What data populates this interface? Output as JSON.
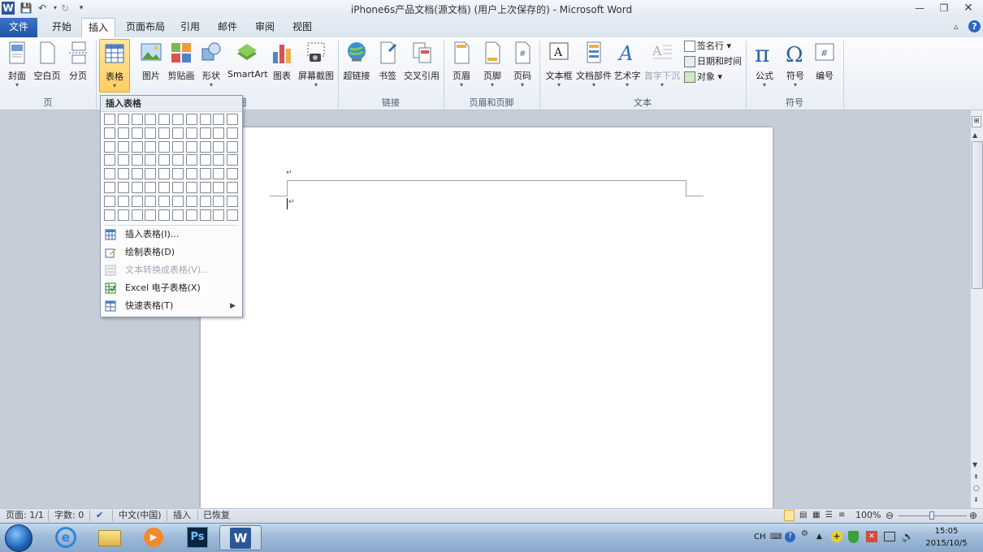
{
  "title": "iPhone6s产品文档(源文档) (用户上次保存的) - Microsoft Word",
  "tabs": {
    "file": "文件",
    "home": "开始",
    "insert": "插入",
    "layout": "页面布局",
    "references": "引用",
    "mail": "邮件",
    "review": "审阅",
    "view": "视图"
  },
  "ribbon": {
    "cover": "封面",
    "blank": "空白页",
    "break": "分页",
    "table": "表格",
    "picture": "图片",
    "clipart": "剪贴画",
    "shapes": "形状",
    "smartart": "SmartArt",
    "chart": "图表",
    "screenshot": "屏幕截图",
    "hyperlink": "超链接",
    "bookmark": "书签",
    "crossref": "交叉引用",
    "header": "页眉",
    "footer": "页脚",
    "pagenum": "页码",
    "textbox": "文本框",
    "quickparts": "文档部件",
    "wordart": "艺术字",
    "dropcap": "首字下沉",
    "signature": "签名行",
    "datetime": "日期和时间",
    "object": "对象",
    "equation": "公式",
    "symbol": "符号",
    "number": "编号",
    "groups": {
      "pages": "页",
      "links": "链接",
      "headerfooter": "页眉和页脚",
      "text": "文本",
      "symbols": "符号",
      "illus_tail": "图"
    }
  },
  "dropdown": {
    "header": "插入表格",
    "items": [
      "插入表格(I)...",
      "绘制表格(D)",
      "文本转换成表格(V)...",
      "Excel 电子表格(X)",
      "快速表格(T)"
    ]
  },
  "doc": {
    "para_mark": "↵"
  },
  "status": {
    "page": "页面: 1/1",
    "words": "字数: 0",
    "lang": "中文(中国)",
    "mode": "插入",
    "recovered": "已恢复",
    "zoom": "100%"
  },
  "taskbar": {
    "lang": "CH",
    "time": "15:05",
    "date": "2015/10/5"
  },
  "colors": {
    "accent": "#1f56a7",
    "ribbon": "#e9eef5",
    "doc_bg": "#c6cdd8"
  }
}
